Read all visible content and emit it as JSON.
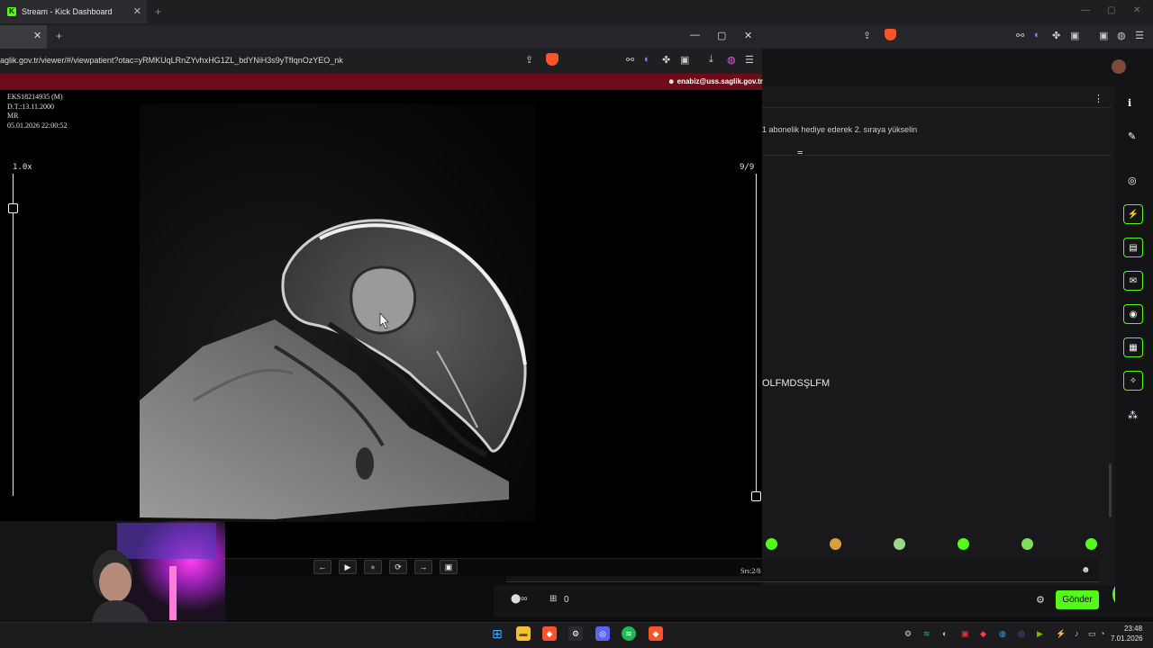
{
  "back_browser": {
    "tab_title": "Stream - Kick Dashboard",
    "tab_close": "✕",
    "new_tab": "+",
    "controls": {
      "minimize": "—",
      "maximize": "▢",
      "close": "✕"
    }
  },
  "kick_dashboard": {
    "more_menu": "⋮",
    "gift_prompt": "1 abonelik hediye ederek 2. sıraya yükselin",
    "filter_icon": "≡",
    "chat_message": "OLFMDSŞLFM",
    "emoji_icon": "☻",
    "points_icon": "⬤∞",
    "gift_count_icon": "⊞",
    "gift_count": "0",
    "settings_icon": "⚙",
    "send_label": "Gönder",
    "help_icon": "?",
    "rail": {
      "info": "ℹ",
      "edit": "✎",
      "focus": "◎",
      "bolt": "⚡",
      "doc": "▤",
      "chat": "✉",
      "broadcast": "◉",
      "layout": "▦",
      "tools": "✧",
      "share": "⁂"
    }
  },
  "viewer_browser": {
    "tab_close": "✕",
    "new_tab": "+",
    "controls": {
      "minimize": "—",
      "maximize": "▢",
      "close": "✕"
    },
    "url": "aglik.gov.tr/viewer/#/viewpatient?otac=yRMKUqLRnZYvhxHG1ZL_bdYNiH3s9yTfIqnOzYEO_nk",
    "share_icon": "⇪",
    "toolbar_icons": {
      "reader": "⚯",
      "audio": "◐",
      "extensions": "✤",
      "wallet": "▣",
      "download": "⤓",
      "vpn": "◍",
      "menu": "☰"
    },
    "user_email": "enabiz@uss.saglik.gov.tr"
  },
  "dicom": {
    "patient_id": "EKS18214935 (M)",
    "birth_date": "D.T.:13.11.2000",
    "modality": "MR",
    "study_datetime": "05.01.2026 22:00:52",
    "zoom": "1.0x",
    "frame": "9/9",
    "series": "Srs:2/8",
    "player": {
      "prev": "←",
      "play": "▶",
      "stop": "●",
      "loop": "⟳",
      "next": "→",
      "save": "▣"
    }
  },
  "taskbar": {
    "time": "23:48",
    "date": "7.01.2026",
    "start_icon": "⊞",
    "apps": {
      "explorer": "▬",
      "brave": "◆",
      "steam": "⚙",
      "discord": "◎",
      "spotify": "≋",
      "brave2": "◆"
    },
    "tray_icons": [
      "⚙",
      "≋",
      "◐",
      "▣",
      "◆",
      "◍",
      "◎",
      "▶",
      "⚡",
      "♪",
      "▭",
      "◔",
      "♫"
    ]
  },
  "colors": {
    "kick_green": "#53fc18",
    "site_bar": "#6b0d19",
    "brave_orange": "#fb542b"
  }
}
